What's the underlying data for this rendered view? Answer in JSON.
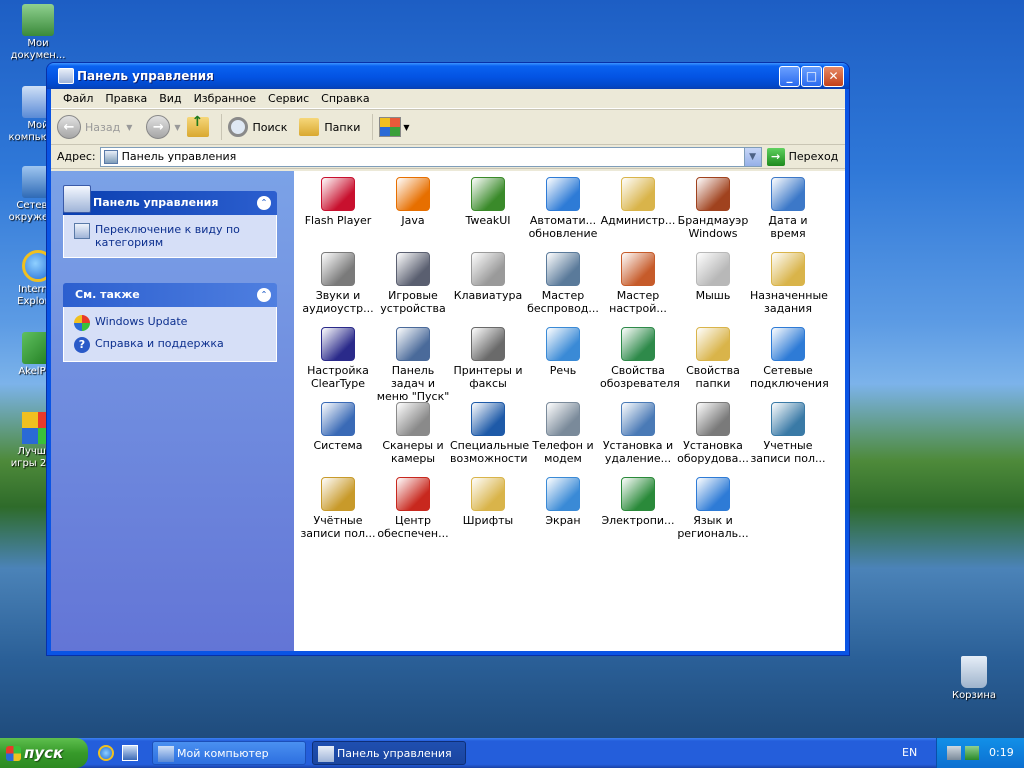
{
  "desktop": {
    "icons": [
      {
        "label": "Мои докумен..."
      },
      {
        "label": "Мой компьютер"
      },
      {
        "label": "Сетевое окружение"
      },
      {
        "label": "Internet Explorer"
      },
      {
        "label": "AkelPad"
      },
      {
        "label": "Лучшие игры 2018"
      },
      {
        "label": "Корзина"
      }
    ]
  },
  "window": {
    "title": "Панель управления",
    "minimize": "_",
    "maximize": "□",
    "close": "✕"
  },
  "menubar": [
    "Файл",
    "Правка",
    "Вид",
    "Избранное",
    "Сервис",
    "Справка"
  ],
  "toolbar": {
    "back": "Назад",
    "forward": "",
    "search": "Поиск",
    "folders": "Папки"
  },
  "address": {
    "label": "Адрес:",
    "value": "Панель управления",
    "go": "Переход"
  },
  "taskpane": {
    "primary_title": "Панель управления",
    "primary_link": "Переключение к виду по категориям",
    "secondary_title": "См. также",
    "links": [
      "Windows Update",
      "Справка и поддержка"
    ]
  },
  "items": [
    {
      "label": "Flash Player",
      "color": "#c8102e"
    },
    {
      "label": "Java",
      "color": "#e76f00"
    },
    {
      "label": "TweakUI",
      "color": "#3a8a2a"
    },
    {
      "label": "Автомати... обновление",
      "color": "#2e7bd6"
    },
    {
      "label": "Администр...",
      "color": "#d9b44a"
    },
    {
      "label": "Брандмауэр Windows",
      "color": "#a0421e"
    },
    {
      "label": "Дата и время",
      "color": "#3c78c8"
    },
    {
      "label": "Звуки и аудиоустр...",
      "color": "#7a7a7a"
    },
    {
      "label": "Игровые устройства",
      "color": "#5a5f70"
    },
    {
      "label": "Клавиатура",
      "color": "#9a9a9a"
    },
    {
      "label": "Мастер беспровод...",
      "color": "#5a7a9a"
    },
    {
      "label": "Мастер настрой...",
      "color": "#c65b2a"
    },
    {
      "label": "Мышь",
      "color": "#b8b8b8"
    },
    {
      "label": "Назначенные задания",
      "color": "#d9b44a"
    },
    {
      "label": "Настройка ClearType",
      "color": "#2a2a8a"
    },
    {
      "label": "Панель задач и меню \"Пуск\"",
      "color": "#4a6a9a"
    },
    {
      "label": "Принтеры и факсы",
      "color": "#6a6a6a"
    },
    {
      "label": "Речь",
      "color": "#3a8ad6"
    },
    {
      "label": "Свойства обозревателя",
      "color": "#2e8a4a"
    },
    {
      "label": "Свойства папки",
      "color": "#d9b44a"
    },
    {
      "label": "Сетевые подключения",
      "color": "#2e7bd6"
    },
    {
      "label": "Система",
      "color": "#3a6ab6"
    },
    {
      "label": "Сканеры и камеры",
      "color": "#8a8a8a"
    },
    {
      "label": "Специальные возможности",
      "color": "#1e5aa8"
    },
    {
      "label": "Телефон и модем",
      "color": "#7a8a9a"
    },
    {
      "label": "Установка и удаление...",
      "color": "#4a7ab6"
    },
    {
      "label": "Установка оборудова...",
      "color": "#7a7a7a"
    },
    {
      "label": "Учетные записи пол...",
      "color": "#3a7aa6"
    },
    {
      "label": "Учётные записи пол...",
      "color": "#c89a2a"
    },
    {
      "label": "Центр обеспечен...",
      "color": "#c8281e"
    },
    {
      "label": "Шрифты",
      "color": "#d9b44a"
    },
    {
      "label": "Экран",
      "color": "#3a8ad6"
    },
    {
      "label": "Электропи...",
      "color": "#2a8a3a"
    },
    {
      "label": "Язык и региональ...",
      "color": "#2e7bd6"
    }
  ],
  "taskbar": {
    "start": "пуск",
    "tasks": [
      "Мой компьютер",
      "Панель управления"
    ],
    "lang": "EN",
    "clock": "0:19"
  }
}
